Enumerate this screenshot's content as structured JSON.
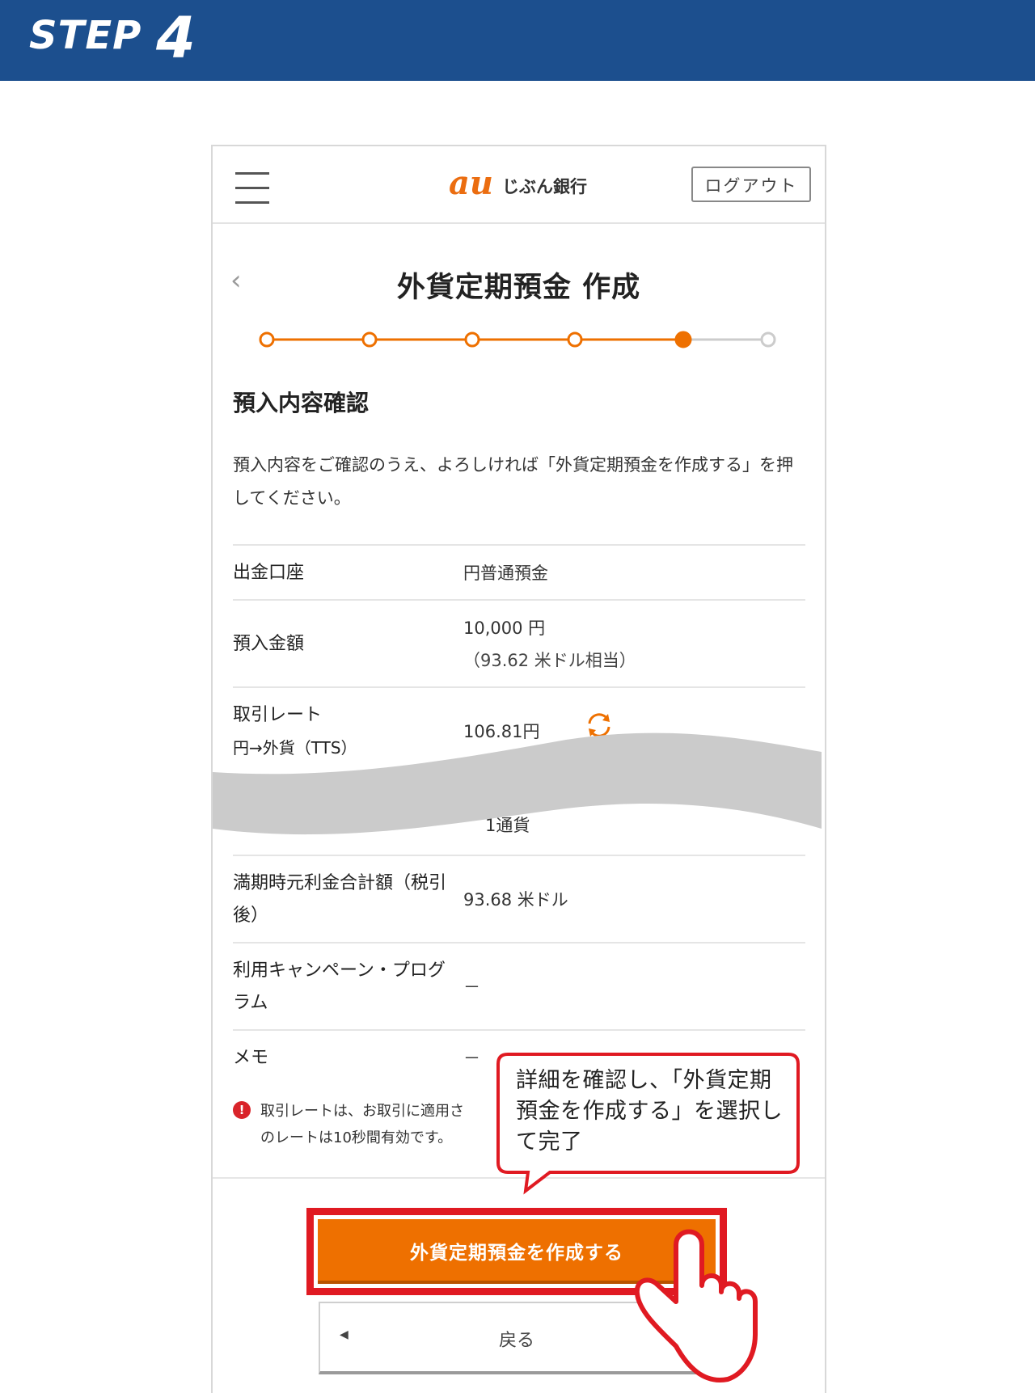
{
  "step": {
    "label": "STEP",
    "number": "4"
  },
  "header": {
    "menu_icon": "hamburger-menu-icon",
    "logo_mark": "au",
    "logo_text": "じぶん銀行",
    "logout_label": "ログアウト"
  },
  "page": {
    "back_icon": "chevron-left-icon",
    "title": "外貨定期預金 作成",
    "progress": {
      "total_steps": 6,
      "current_step": 5
    }
  },
  "section": {
    "title": "預入内容確認",
    "intro": "預入内容をご確認のうえ、よろしければ「外貨定期預金を作成する」を押してください。"
  },
  "rows": [
    {
      "label": "出金口座",
      "value": "円普通預金"
    },
    {
      "label": "預入金額",
      "value": "10,000 円",
      "sub": "（93.62 米ドル相当）"
    },
    {
      "label": "取引レート",
      "label_sub": "円→外貨（TTS）",
      "value": "106.81円",
      "icon": "refresh-icon"
    },
    {
      "label": "",
      "value": "1通貨"
    },
    {
      "label": "満期時元利金合計額（税引後）",
      "value": "93.68 米ドル"
    },
    {
      "label": "利用キャンペーン・プログラム",
      "value": "－"
    },
    {
      "label": "メモ",
      "value": "－"
    }
  ],
  "note": {
    "icon": "alert-circle-icon",
    "text_line1": "取引レートは、お取引に適用さ",
    "text_line2": "のレートは10秒間有効です。"
  },
  "buttons": {
    "create": "外貨定期預金を作成する",
    "back": "戻る",
    "back_icon": "triangle-left-icon"
  },
  "callout": {
    "text": "詳細を確認し、「外貨定期預金を作成する」を選択して完了"
  },
  "colors": {
    "banner": "#1c4f8e",
    "accent_orange": "#ee7000",
    "highlight_red": "#e01a22"
  }
}
